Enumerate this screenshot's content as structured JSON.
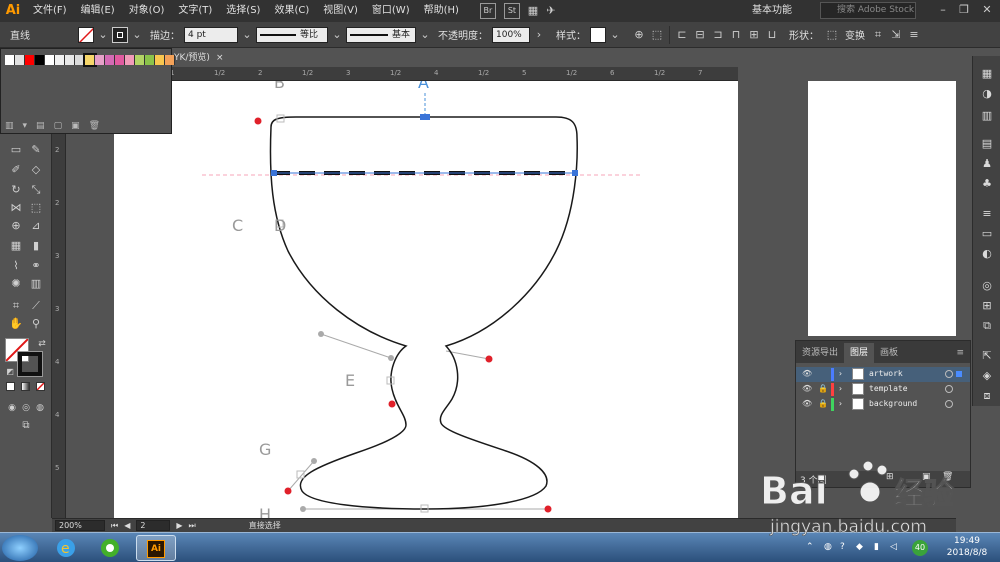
{
  "app": {
    "logo": "Ai",
    "menu": [
      "文件(F)",
      "编辑(E)",
      "对象(O)",
      "文字(T)",
      "选择(S)",
      "效果(C)",
      "视图(V)",
      "窗口(W)",
      "帮助(H)"
    ],
    "bridge_label": "Br",
    "stock_label": "St",
    "workspace": "基本功能",
    "search_placeholder": "搜索 Adobe Stock",
    "window_controls": [
      "–",
      "❐",
      "✕"
    ]
  },
  "control_bar": {
    "tool_name": "直线",
    "stroke_label": "描边：",
    "stroke_weight": "4 pt",
    "profile_label": "等比",
    "brush_label": "基本",
    "opacity_label": "不透明度：",
    "opacity_value": "100%",
    "style_label": "样式：",
    "shape_label": "形状：",
    "transform_label": "变换"
  },
  "document": {
    "tab_label": "YK/预览)",
    "close_glyph": "×"
  },
  "swatches": {
    "colors": [
      "#ffffff",
      "#e0e0e0",
      "#ff0000",
      "#000000",
      "#ffffff",
      "#f0f0f0",
      "#e8e8e8",
      "#dcdcdc",
      "#f6d66a",
      "#e6a0c8",
      "#d46ab4",
      "#e25aa0",
      "#f29ab9",
      "#b3d465",
      "#8bc34a",
      "#f9c74f",
      "#f4a259"
    ]
  },
  "rulers": {
    "top_ticks": [
      "0",
      "1/2",
      "1",
      "1/2",
      "2",
      "1/2",
      "3",
      "1/2",
      "4",
      "1/2",
      "5",
      "1/2",
      "6",
      "1/2",
      "7",
      "1/2"
    ],
    "left_ticks": [
      "1",
      "2",
      "2",
      "3",
      "3",
      "4",
      "4",
      "5"
    ]
  },
  "guide_labels": [
    "A",
    "B",
    "C",
    "D",
    "E",
    "G",
    "H"
  ],
  "status_bar": {
    "zoom": "200%",
    "artboard": "2",
    "tool_status": "直接选择"
  },
  "layers_panel": {
    "tabs": [
      "资源导出",
      "图层",
      "画板"
    ],
    "active_tab": "图层",
    "layers": [
      {
        "name": "artwork",
        "color": "#4a7cff",
        "locked": false,
        "selected": true
      },
      {
        "name": "template",
        "color": "#ff4040",
        "locked": true,
        "selected": false
      },
      {
        "name": "background",
        "color": "#3fd45f",
        "locked": true,
        "selected": false
      }
    ],
    "footer_count": "3 个图"
  },
  "taskbar": {
    "ai_label": "Ai",
    "time": "19:49",
    "date": "2018/8/8",
    "badge": "40"
  },
  "watermark": {
    "brand": "Bai",
    "brand_cn": "经验",
    "url": "jingyan.baidu.com"
  }
}
